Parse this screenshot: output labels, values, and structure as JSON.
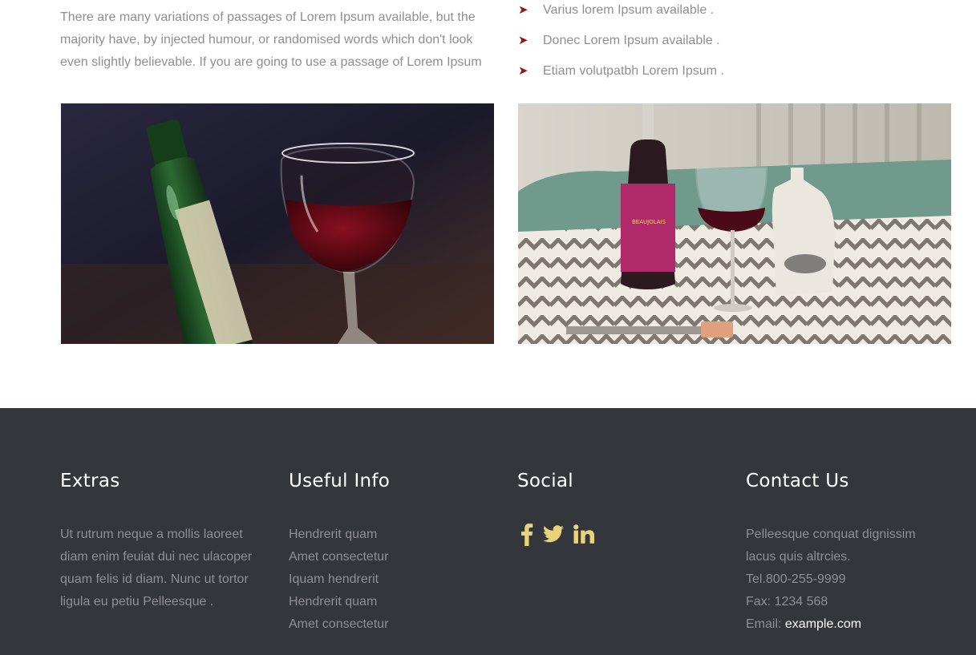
{
  "intro": {
    "text": "There are many variations of passages of Lorem Ipsum available, but the majority have, by injected humour, or randomised words which don't look even slightly believable. If you are going to use a passage of Lorem Ipsum"
  },
  "features": [
    {
      "icon": "arrow-icon",
      "label": "Varius lorem Ipsum available ."
    },
    {
      "icon": "arrow-icon",
      "label": "Donec Lorem Ipsum available ."
    },
    {
      "icon": "arrow-icon",
      "label": "Etiam volutpatbh Lorem Ipsum ."
    }
  ],
  "colors": {
    "accent_arrow": "#8b1a1a",
    "footer_bg": "#33363b",
    "social_icon": "#e8d27a",
    "text_muted": "#8f8f8f"
  },
  "footer": {
    "extras": {
      "title": "Extras",
      "text": "Ut rutrum neque a mollis laoreet diam enim feuiat dui nec ulacoper quam felis id diam. Nunc ut tortor ligula eu petiu Pelleesque ."
    },
    "useful": {
      "title": "Useful Info",
      "links": [
        "Hendrerit quam",
        "Amet consectetur",
        "Iquam hendrerit",
        "Hendrerit quam",
        "Amet consectetur"
      ]
    },
    "social": {
      "title": "Social",
      "icons": [
        "facebook-icon",
        "twitter-icon",
        "linkedin-icon"
      ]
    },
    "contact": {
      "title": "Contact Us",
      "address": "Pelleesque conquat dignissim lacus quis altrcies.",
      "tel": "Tel.800-255-9999",
      "fax": "Fax: 1234 568",
      "email_label": "Email: ",
      "email_value": "example.com"
    }
  }
}
